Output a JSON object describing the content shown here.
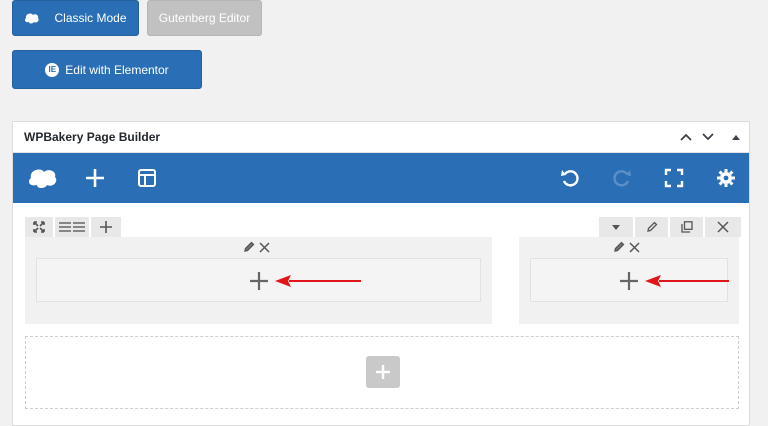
{
  "buttons": {
    "classic_mode": "Classic Mode",
    "gutenberg_editor": "Gutenberg Editor",
    "edit_elementor": "Edit with Elementor",
    "elementor_glyph": "IE"
  },
  "panel": {
    "title": "WPBakery Page Builder"
  },
  "colors": {
    "primary": "#2a6fb5",
    "disabled": "#c1c1c1",
    "arrow": "#e0161b"
  },
  "icons": {
    "toolbar": [
      "wpbakery-logo-icon",
      "add-element-icon",
      "templates-icon",
      "undo-icon",
      "redo-icon",
      "fullscreen-icon",
      "settings-icon"
    ],
    "row": [
      "move-icon",
      "layout-icon",
      "add-column-icon",
      "dropdown-icon",
      "edit-pencil-icon",
      "clone-icon",
      "close-icon"
    ]
  }
}
